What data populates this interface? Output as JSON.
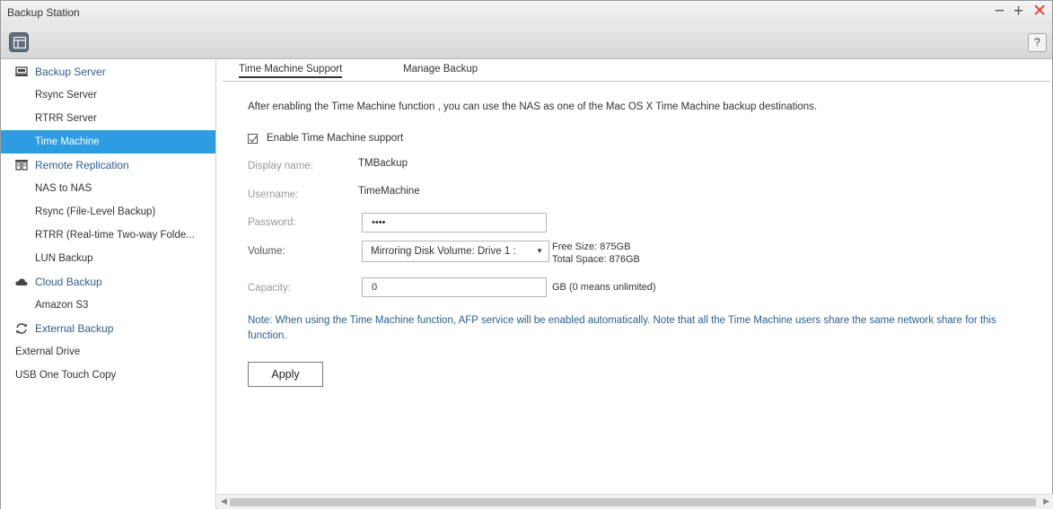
{
  "window": {
    "title": "Backup Station",
    "minimize": "−",
    "maximize": "+",
    "close": "✕"
  },
  "toolbar": {
    "menu_icon": "menu-grid-icon",
    "help_label": "?"
  },
  "sidebar": {
    "groups": [
      {
        "label": "Backup Server",
        "icon": "server-icon",
        "items": [
          "Rsync Server",
          "RTRR Server",
          "Time Machine"
        ]
      },
      {
        "label": "Remote Replication",
        "icon": "replication-icon",
        "items": [
          "NAS to NAS",
          "Rsync (File-Level Backup)",
          "RTRR (Real-time Two-way Folde...",
          "LUN Backup"
        ]
      },
      {
        "label": "Cloud Backup",
        "icon": "cloud-icon",
        "items": [
          "Amazon S3"
        ]
      },
      {
        "label": "External Backup",
        "icon": "sync-icon",
        "items": [
          "External Drive",
          "USB One Touch Copy"
        ]
      }
    ],
    "active_item": "Time Machine"
  },
  "tabs": [
    {
      "label": "Time Machine Support",
      "active": true
    },
    {
      "label": "Manage Backup",
      "active": false
    }
  ],
  "main": {
    "intro": "After enabling the Time Machine function , you can use the NAS as one of the Mac OS X Time Machine backup destinations.",
    "enable_label": "Enable Time Machine support",
    "enable_checked": true,
    "display_name_label": "Display name:",
    "display_name_value": "TMBackup",
    "username_label": "Username:",
    "username_value": "TimeMachine",
    "password_label": "Password:",
    "password_value": "••••",
    "volume_label": "Volume:",
    "volume_value": "Mirroring Disk Volume: Drive 1 :",
    "free_size": "Free Size: 875GB",
    "total_space": "Total Space: 876GB",
    "capacity_label": "Capacity:",
    "capacity_value": "0",
    "capacity_unit": "GB (0 means unlimited)",
    "note": "Note: When using the Time Machine function, AFP service will be enabled automatically. Note that all the Time Machine users share the same network share for this function.",
    "apply_label": "Apply"
  },
  "colors": {
    "accent": "#2d9ce0",
    "group_label": "#2f5d8e",
    "close_red": "#e53b2c",
    "note_blue": "#2b5f8f"
  }
}
